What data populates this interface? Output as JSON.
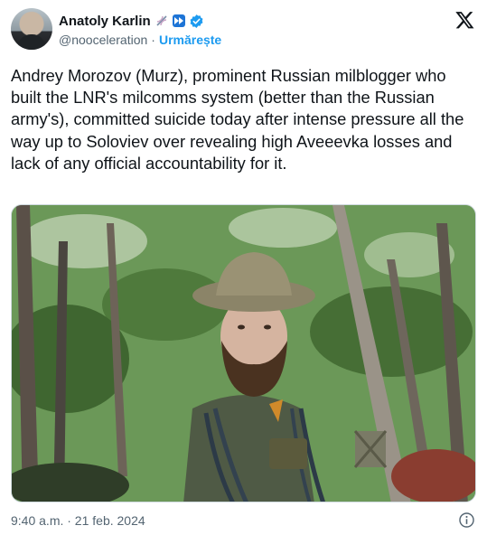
{
  "author": {
    "display_name": "Anatoly Karlin",
    "handle": "@nooceleration",
    "separator": "·",
    "follow_label": "Urmărește",
    "badges": [
      "dna-icon",
      "fast-forward-icon",
      "verified-icon"
    ]
  },
  "tweet": {
    "text": "Andrey Morozov (Murz), prominent Russian milblogger who built the LNR's milcomms system (better than the Russian army's), committed suicide today after intense pressure all the way up to Soloviev over revealing high Aveeevka losses and lack of any official accountability for it.",
    "timestamp": "9:40 a.m. · 21 feb. 2024"
  },
  "icons": {
    "platform_logo": "x-logo-icon",
    "info": "info-icon"
  },
  "colors": {
    "link": "#1d9bf0",
    "verified": "#1d9bf0",
    "secondary_text": "#536471",
    "primary_text": "#0f1419"
  }
}
